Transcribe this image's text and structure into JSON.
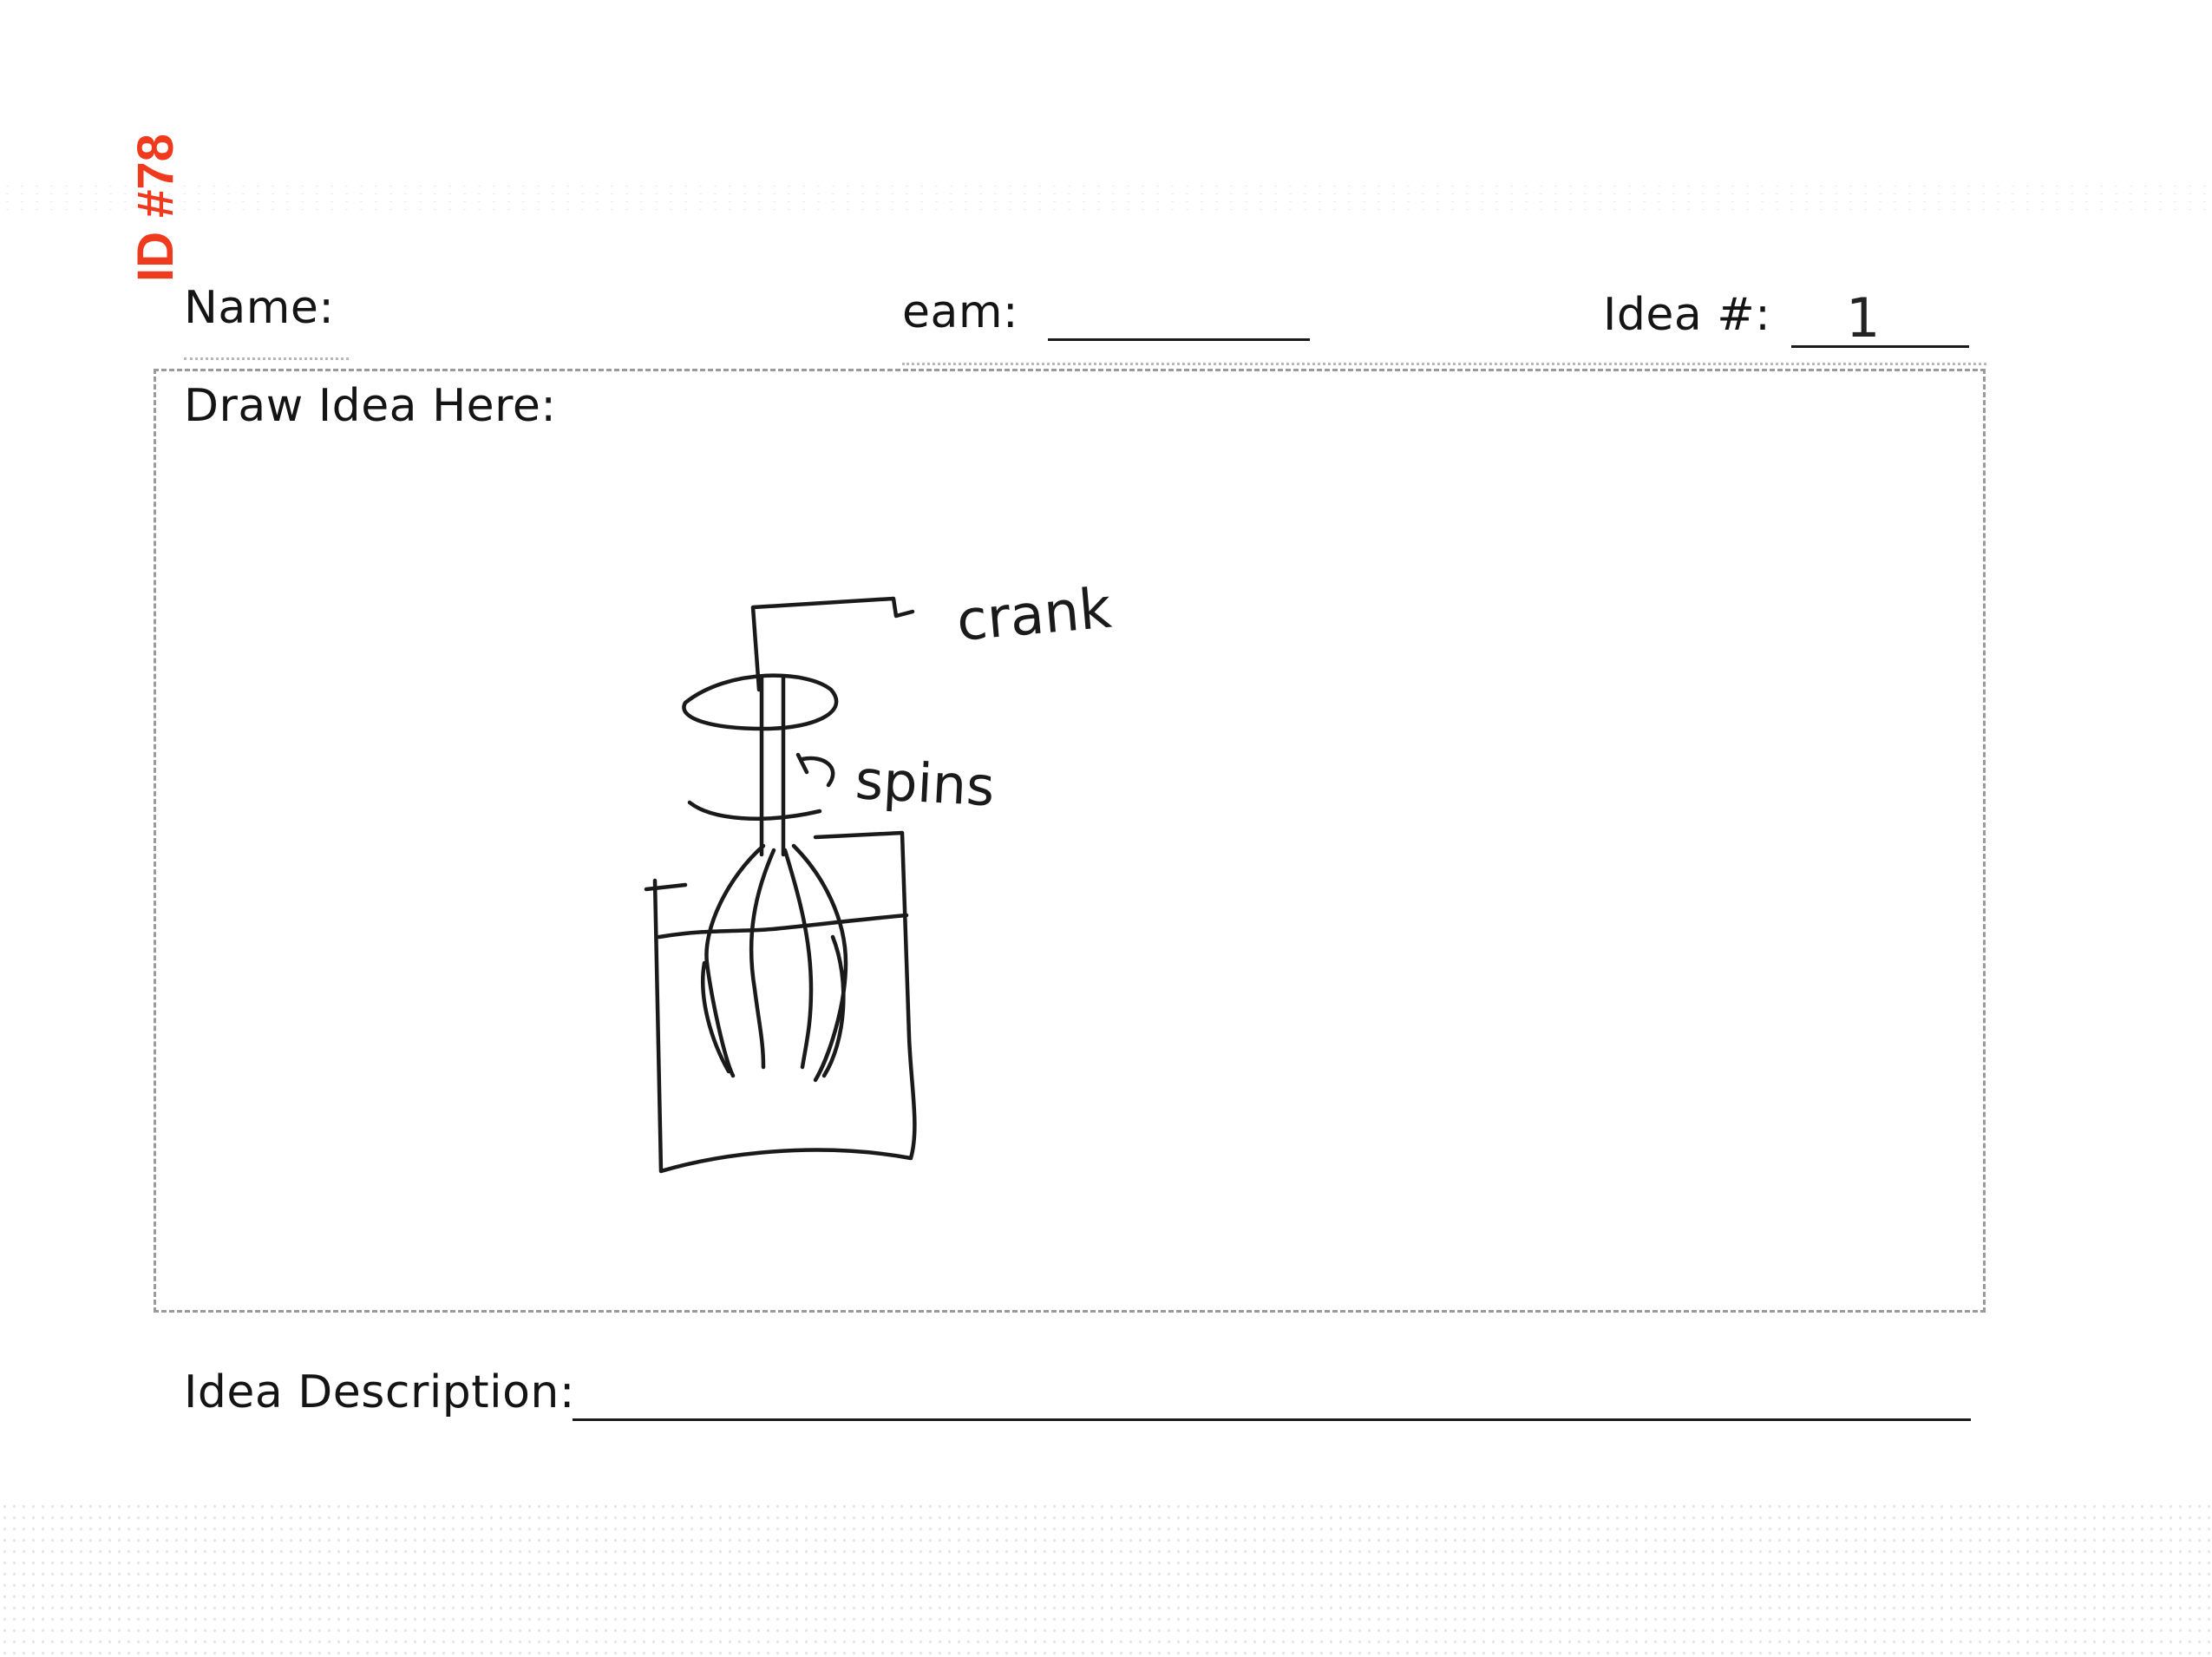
{
  "form": {
    "name_label": "Name:",
    "team_label": "eam:",
    "idea_label": "Idea #:",
    "idea_value": "1",
    "draw_label": "Draw Idea Here:",
    "description_label": "Idea Description:"
  },
  "stamp": {
    "id_text": "ID #78",
    "color": "#f03a1e"
  },
  "sketch": {
    "crank_annotation": "crank",
    "spins_annotation": "spins"
  }
}
